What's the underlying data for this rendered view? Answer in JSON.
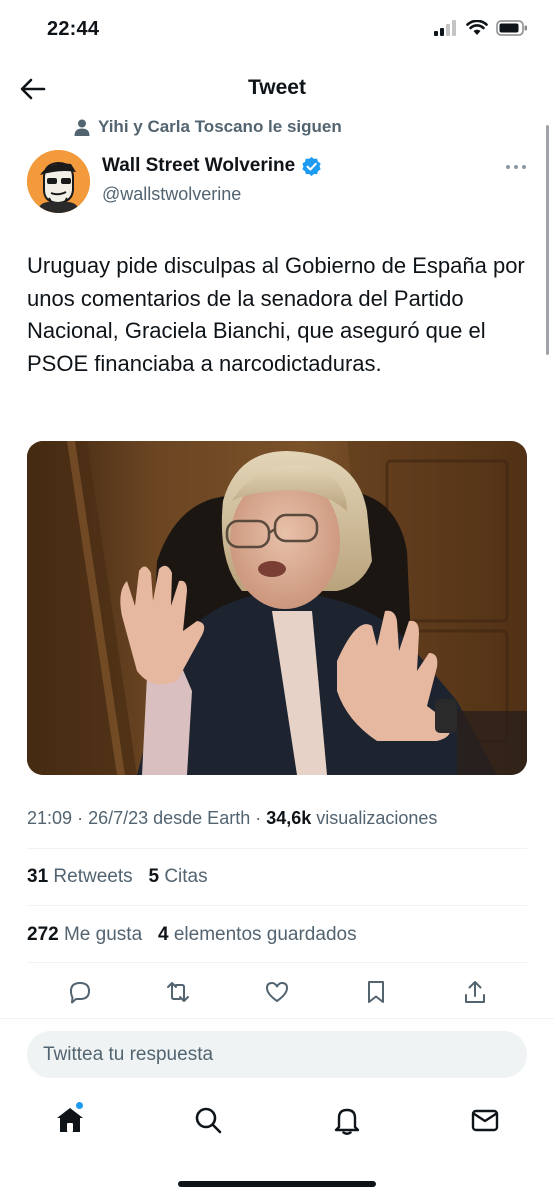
{
  "status_bar": {
    "time": "22:44",
    "icons": [
      "cellular-signal-icon",
      "wifi-icon",
      "battery-icon"
    ]
  },
  "nav": {
    "title": "Tweet",
    "back_icon": "back-arrow-icon"
  },
  "social_context": {
    "text": "Yihi y Carla Toscano le siguen",
    "icon": "person-icon"
  },
  "author": {
    "name": "Wall Street Wolverine",
    "handle": "@wallstwolverine",
    "verified": true,
    "avatar": "avatar-illustration"
  },
  "tweet": {
    "text": "Uruguay pide disculpas al Gobierno de España por unos comentarios de la senadora del Partido Nacional, Graciela Bianchi, que aseguró que el PSOE financiaba a narcodictaduras.",
    "image": "photo of a woman with glasses raising both hands while speaking"
  },
  "meta": {
    "time": "21:09",
    "date": "26/7/23",
    "source": "desde Earth",
    "views": "34,6k",
    "views_label": "visualizaciones"
  },
  "stats": {
    "retweets_count": "31",
    "retweets_label": "Retweets",
    "quotes_count": "5",
    "quotes_label": "Citas",
    "likes_count": "272",
    "likes_label": "Me gusta",
    "bookmarks_count": "4",
    "bookmarks_label": "elementos guardados"
  },
  "actions": [
    "reply-icon",
    "retweet-icon",
    "like-icon",
    "bookmark-icon",
    "share-icon"
  ],
  "reply": {
    "placeholder": "Twittea tu respuesta"
  },
  "tab_bar": [
    "home-icon",
    "search-icon",
    "notifications-icon",
    "messages-icon"
  ],
  "colors": {
    "accent": "#1d9bf0",
    "text": "#0f1419",
    "muted": "#536471",
    "divider": "#eff3f4"
  }
}
